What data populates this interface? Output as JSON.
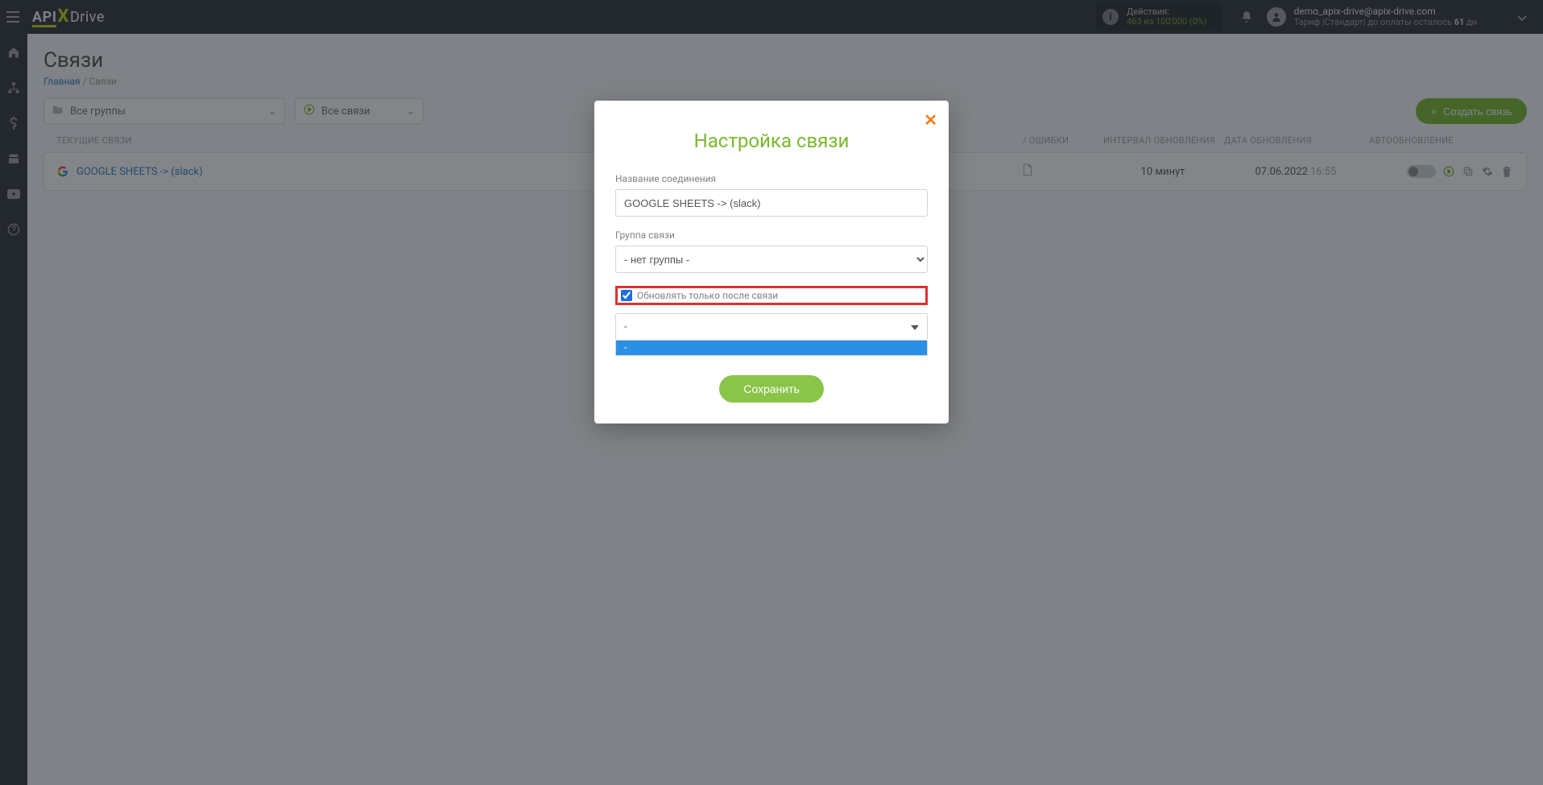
{
  "header": {
    "logo": {
      "api": "API",
      "x": "X",
      "drive": "Drive"
    },
    "actions": {
      "label": "Действия:",
      "detail": "463 из 100'000 (0%)"
    },
    "user": {
      "email": "demo_apix-drive@apix-drive.com",
      "plan_prefix": "Тариф |Стандарт| до оплаты осталось ",
      "plan_days": "61",
      "plan_suffix": " дн"
    }
  },
  "page": {
    "title": "Связи",
    "breadcrumb_home": "Главная",
    "breadcrumb_sep": "/",
    "breadcrumb_current": "Связи"
  },
  "filters": {
    "groups_label": "Все группы",
    "connections_label": "Все связи",
    "create_button": "Создать связь"
  },
  "table": {
    "head_current": "ТЕКУЩИЕ СВЯЗИ",
    "head_errors": "/ ОШИБКИ",
    "head_interval": "ИНТЕРВАЛ ОБНОВЛЕНИЯ",
    "head_date": "ДАТА ОБНОВЛЕНИЯ",
    "head_auto": "АВТООБНОВЛЕНИЕ",
    "rows": [
      {
        "name": "GOOGLE SHEETS -> (slack)",
        "interval": "10 минут",
        "date": "07.06.2022",
        "time": "16:55"
      }
    ]
  },
  "modal": {
    "title": "Настройка связи",
    "label_name": "Название соединения",
    "value_name": "GOOGLE SHEETS -> (slack)",
    "label_group": "Группа связи",
    "value_group": "- нет группы -",
    "checkbox_label": "Обновлять только после связи",
    "select_value": "-",
    "select_option": "-",
    "save_button": "Сохранить"
  }
}
